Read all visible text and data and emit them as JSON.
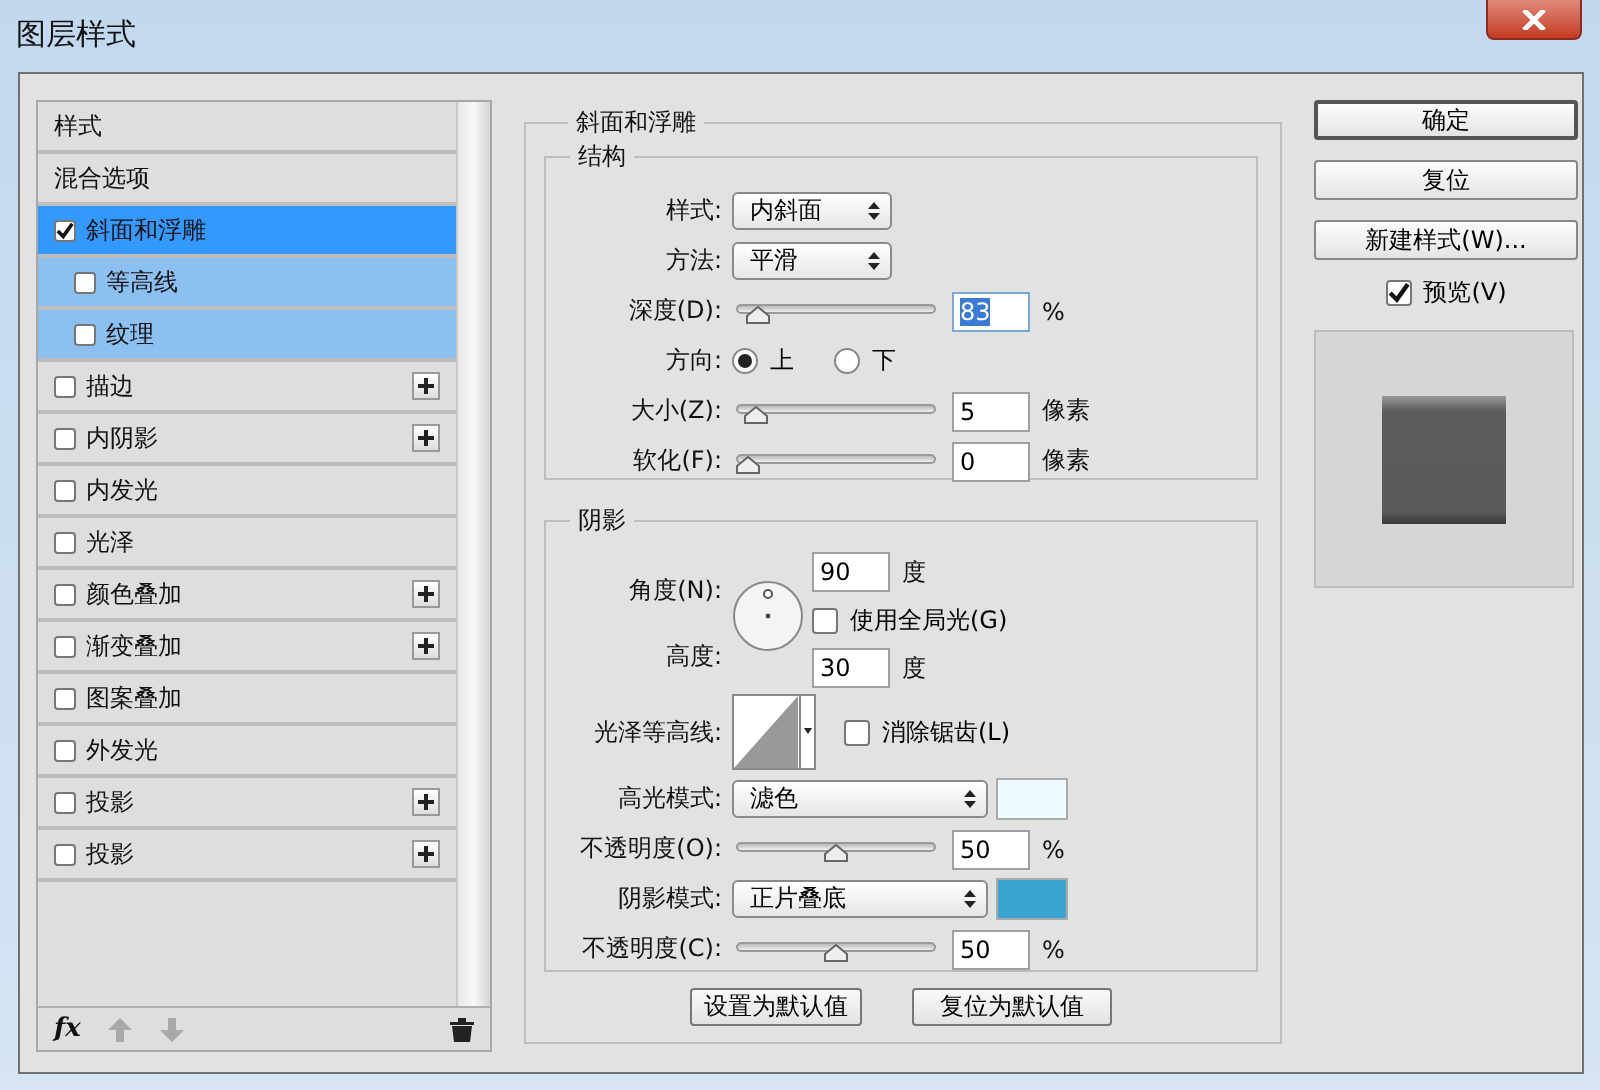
{
  "window": {
    "title": "图层样式"
  },
  "styles_panel": {
    "items": [
      {
        "label": "样式",
        "kind": "header",
        "selected": false
      },
      {
        "label": "混合选项",
        "kind": "header",
        "selected": false
      },
      {
        "label": "斜面和浮雕",
        "kind": "effect",
        "checked": true,
        "selected": true,
        "addable": false,
        "children": [
          {
            "label": "等高线",
            "kind": "effect",
            "checked": false,
            "selected": false,
            "addable": false
          },
          {
            "label": "纹理",
            "kind": "effect",
            "checked": false,
            "selected": false,
            "addable": false
          }
        ]
      },
      {
        "label": "描边",
        "kind": "effect",
        "checked": false,
        "selected": false,
        "addable": true
      },
      {
        "label": "内阴影",
        "kind": "effect",
        "checked": false,
        "selected": false,
        "addable": true
      },
      {
        "label": "内发光",
        "kind": "effect",
        "checked": false,
        "selected": false,
        "addable": false
      },
      {
        "label": "光泽",
        "kind": "effect",
        "checked": false,
        "selected": false,
        "addable": false
      },
      {
        "label": "颜色叠加",
        "kind": "effect",
        "checked": false,
        "selected": false,
        "addable": true
      },
      {
        "label": "渐变叠加",
        "kind": "effect",
        "checked": false,
        "selected": false,
        "addable": true
      },
      {
        "label": "图案叠加",
        "kind": "effect",
        "checked": false,
        "selected": false,
        "addable": false
      },
      {
        "label": "外发光",
        "kind": "effect",
        "checked": false,
        "selected": false,
        "addable": false
      },
      {
        "label": "投影",
        "kind": "effect",
        "checked": false,
        "selected": false,
        "addable": true
      },
      {
        "label": "投影",
        "kind": "effect",
        "checked": false,
        "selected": false,
        "addable": true
      }
    ],
    "toolbar_fx": "fx"
  },
  "bevel": {
    "title": "斜面和浮雕",
    "structure": {
      "title": "结构",
      "style": {
        "label": "样式:",
        "value": "内斜面"
      },
      "technique": {
        "label": "方法:",
        "value": "平滑"
      },
      "depth": {
        "label": "深度(D):",
        "level": 0.06,
        "value": "83",
        "text_selected": true,
        "unit": "%"
      },
      "direction": {
        "label": "方向:",
        "options": [
          {
            "label": "上",
            "selected": true
          },
          {
            "label": "下",
            "selected": false
          }
        ]
      },
      "size": {
        "label": "大小(Z):",
        "level": 0.05,
        "value": "5",
        "text_selected": false,
        "unit": "像素"
      },
      "soften": {
        "label": "软化(F):",
        "level": 0.0,
        "value": "0",
        "text_selected": false,
        "unit": "像素"
      }
    },
    "shading": {
      "title": "阴影",
      "angle": {
        "label": "角度(N):",
        "value": "90",
        "unit": "度"
      },
      "global_light": {
        "label": "使用全局光(G)",
        "checked": false
      },
      "altitude": {
        "label": "高度:",
        "value": "30",
        "unit": "度"
      },
      "gloss_contour": {
        "label": "光泽等高线:"
      },
      "anti_aliased": {
        "label": "消除锯齿(L)",
        "checked": false
      },
      "highlight_mode": {
        "label": "高光模式:",
        "value": "滤色",
        "color": "#eefafd"
      },
      "highlight_opacity": {
        "label": "不透明度(O):",
        "level": 0.5,
        "value": "50",
        "text_selected": false,
        "unit": "%"
      },
      "shadow_mode": {
        "label": "阴影模式:",
        "value": "正片叠底",
        "color": "#3aa4d2"
      },
      "shadow_opacity": {
        "label": "不透明度(C):",
        "level": 0.5,
        "value": "50",
        "text_selected": false,
        "unit": "%"
      }
    },
    "buttons": [
      "设置为默认值",
      "复位为默认值"
    ]
  },
  "actions": {
    "buttons": [
      {
        "label": "确定",
        "default": true
      },
      {
        "label": "复位",
        "default": false
      },
      {
        "label": "新建样式(W)...",
        "default": false
      }
    ],
    "preview": {
      "label": "预览(V)",
      "checked": true
    }
  }
}
